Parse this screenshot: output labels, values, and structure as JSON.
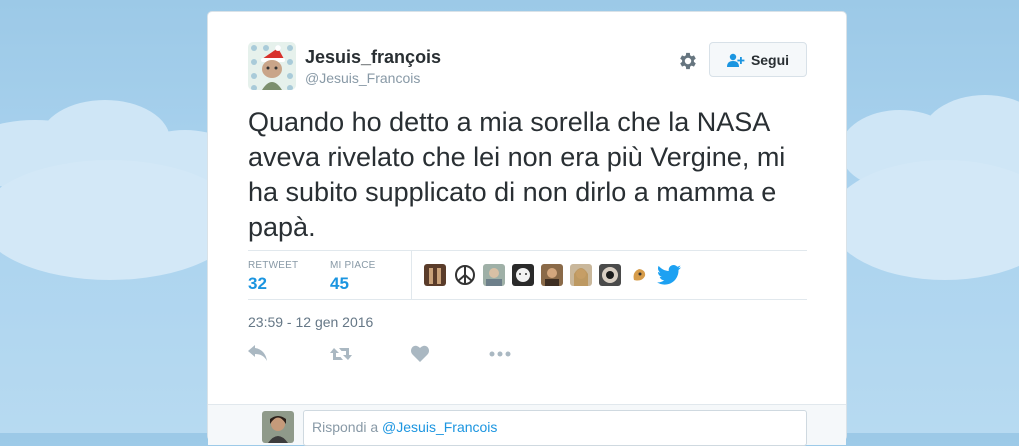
{
  "tweet": {
    "display_name": "Jesuis_françois",
    "handle": "@Jesuis_Francois",
    "text": "Quando ho detto a mia sorella che la NASA aveva rivelato che lei non era più Vergine, mi ha subito supplicato di non dirlo a mamma e papà.",
    "timestamp": "23:59 - 12 gen 2016"
  },
  "follow_button": {
    "label": "Segui",
    "icon": "add-user-icon"
  },
  "stats": {
    "retweets_label": "RETWEET",
    "retweets_value": "32",
    "likes_label": "MI PIACE",
    "likes_value": "45"
  },
  "likers": [
    {
      "name": "liker-1"
    },
    {
      "name": "liker-2"
    },
    {
      "name": "liker-3"
    },
    {
      "name": "liker-4"
    },
    {
      "name": "liker-5"
    },
    {
      "name": "liker-6"
    },
    {
      "name": "liker-7"
    },
    {
      "name": "liker-8"
    }
  ],
  "actions": [
    "reply-icon",
    "retweet-icon",
    "like-icon",
    "more-icon"
  ],
  "reply": {
    "prefix": "Rispondi a ",
    "mention": "@Jesuis_Francois"
  },
  "colors": {
    "accent": "#1b95e0",
    "sky": "#a9d2ee",
    "text": "#292f33",
    "muted": "#8899a6"
  }
}
